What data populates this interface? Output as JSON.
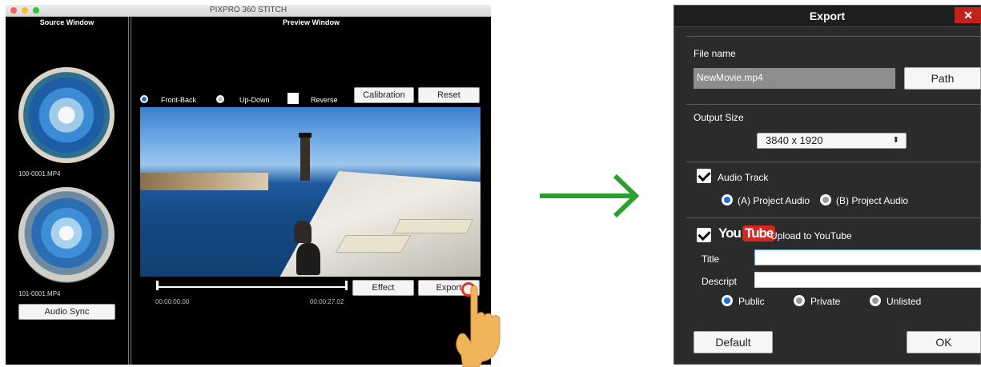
{
  "app": {
    "title": "PIXPRO 360 STITCH",
    "source_window_title": "Source Window",
    "preview_window_title": "Preview Window",
    "files": [
      {
        "name": "100-0001.MP4"
      },
      {
        "name": "101-0001.MP4"
      }
    ],
    "audio_sync_label": "Audio Sync",
    "options": {
      "front_back": "Front-Back",
      "up_down": "Up-Down",
      "reverse": "Reverse",
      "selected": "Front-Back"
    },
    "calibration_label": "Calibration",
    "reset_label": "Reset",
    "effect_label": "Effect",
    "export_label": "Export",
    "timeline": {
      "start": "00:00:00.00",
      "end": "00:00:27.02"
    }
  },
  "export_dialog": {
    "title": "Export",
    "close_label": "✕",
    "file_name_label": "File name",
    "file_name_value": "NewMovie.mp4",
    "path_label": "Path",
    "output_size_label": "Output Size",
    "output_size_value": "3840 x 1920",
    "audio_track_label": "Audio Track",
    "audio_track_checked": true,
    "audio_a_label": "(A) Project Audio",
    "audio_b_label": "(B) Project Audio",
    "audio_selected": "A",
    "youtube_logo_you": "You",
    "youtube_logo_tube": "Tube",
    "upload_label": "Upload to YouTube",
    "upload_checked": true,
    "title_label": "Title",
    "title_value": "",
    "descript_label": "Descript",
    "descript_value": "",
    "privacy_public": "Public",
    "privacy_private": "Private",
    "privacy_unlisted": "Unlisted",
    "privacy_selected": "Public",
    "default_label": "Default",
    "ok_label": "OK"
  },
  "colors": {
    "arrow": "#2ca02c",
    "radio_selected": "#1a6ed8",
    "close_button": "#c3211b",
    "youtube_red": "#d7261f",
    "highlight_ring": "#e53226"
  }
}
